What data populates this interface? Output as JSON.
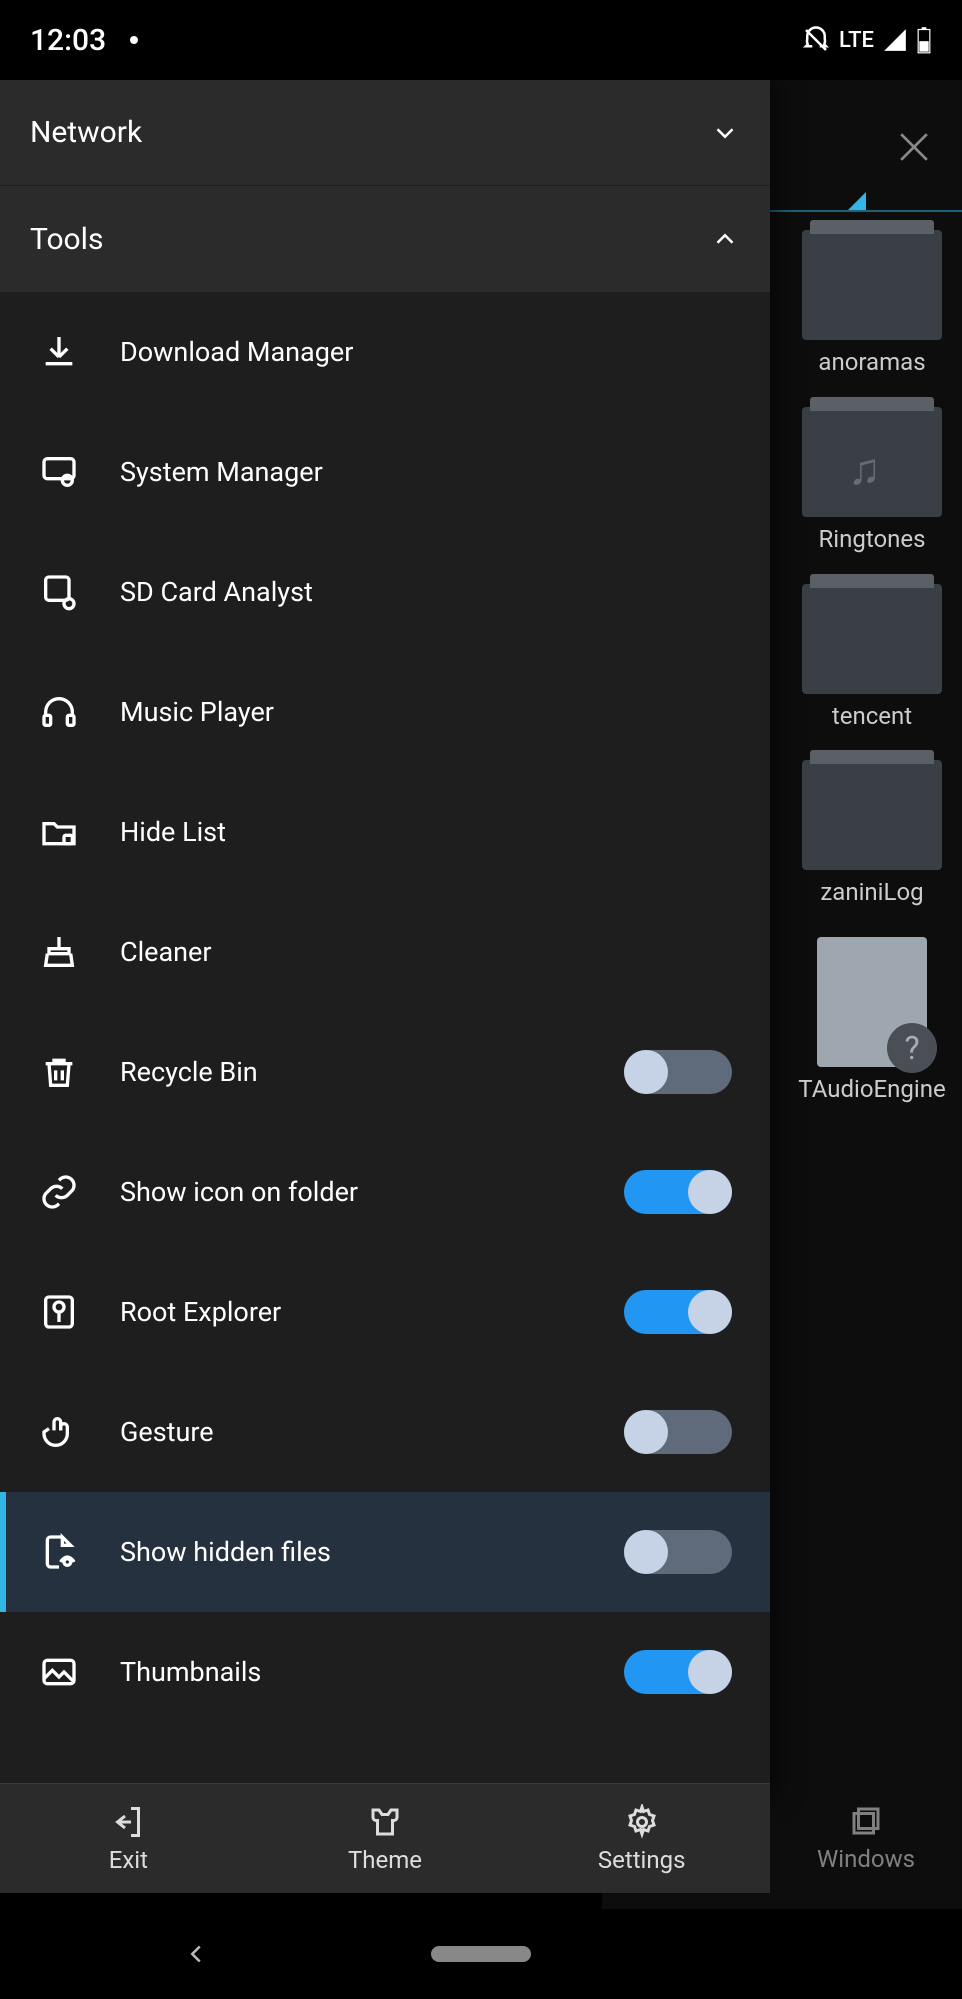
{
  "status": {
    "time": "12:03",
    "network": "LTE"
  },
  "drawer": {
    "sections": {
      "network": "Network",
      "tools": "Tools"
    },
    "tools": [
      {
        "id": "download-manager",
        "label": "Download Manager",
        "icon": "download"
      },
      {
        "id": "system-manager",
        "label": "System Manager",
        "icon": "system"
      },
      {
        "id": "sd-card-analyst",
        "label": "SD Card Analyst",
        "icon": "sdcard"
      },
      {
        "id": "music-player",
        "label": "Music Player",
        "icon": "headphones"
      },
      {
        "id": "hide-list",
        "label": "Hide List",
        "icon": "folder-lock"
      },
      {
        "id": "cleaner",
        "label": "Cleaner",
        "icon": "broom"
      },
      {
        "id": "recycle-bin",
        "label": "Recycle Bin",
        "icon": "trash",
        "toggle": "off"
      },
      {
        "id": "show-icon-on-folder",
        "label": "Show icon on folder",
        "icon": "link",
        "toggle": "on"
      },
      {
        "id": "root-explorer",
        "label": "Root Explorer",
        "icon": "root",
        "toggle": "on"
      },
      {
        "id": "gesture",
        "label": "Gesture",
        "icon": "gesture",
        "toggle": "off"
      },
      {
        "id": "show-hidden-files",
        "label": "Show hidden files",
        "icon": "file-eye",
        "toggle": "off",
        "highlight": true
      },
      {
        "id": "thumbnails",
        "label": "Thumbnails",
        "icon": "image",
        "toggle": "on"
      }
    ],
    "bottom": {
      "exit": "Exit",
      "theme": "Theme",
      "settings": "Settings"
    }
  },
  "background": {
    "folders": [
      {
        "id": "panoramas",
        "label": "anoramas",
        "type": "folder"
      },
      {
        "id": "ringtones",
        "label": "Ringtones",
        "type": "folder-music"
      },
      {
        "id": "tencent",
        "label": "tencent",
        "type": "folder"
      },
      {
        "id": "zaninilog",
        "label": "zaniniLog",
        "type": "folder"
      },
      {
        "id": "qtaudio",
        "label": "TAudioEngine",
        "type": "file-unknown"
      }
    ],
    "windows": "Windows"
  }
}
